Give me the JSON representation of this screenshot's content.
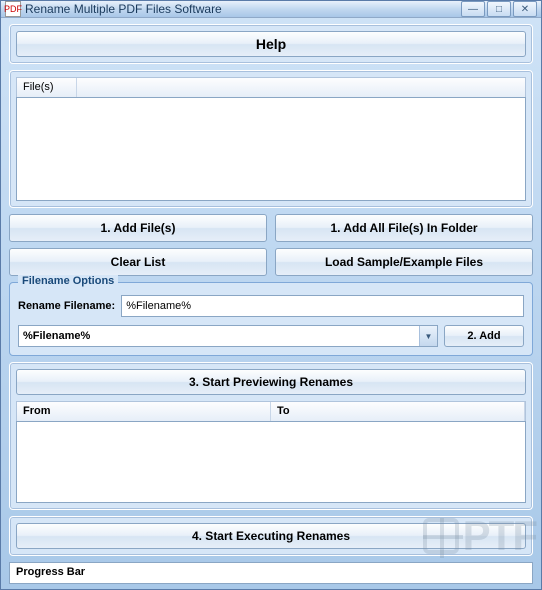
{
  "window": {
    "title": "Rename Multiple PDF Files Software",
    "icon_text": "PDF"
  },
  "help": {
    "label": "Help"
  },
  "files": {
    "header": "File(s)"
  },
  "buttons": {
    "add_files": "1. Add File(s)",
    "add_folder": "1. Add All File(s) In Folder",
    "clear_list": "Clear List",
    "load_sample": "Load Sample/Example Files"
  },
  "filename_options": {
    "legend": "Filename Options",
    "rename_label": "Rename Filename:",
    "rename_value": "%Filename%",
    "dropdown_value": "%Filename%",
    "add_button": "2. Add"
  },
  "preview": {
    "button": "3. Start Previewing Renames",
    "col_from": "From",
    "col_to": "To"
  },
  "execute": {
    "button": "4. Start Executing Renames"
  },
  "progress": {
    "text": "Progress Bar"
  },
  "watermark": "PTF"
}
